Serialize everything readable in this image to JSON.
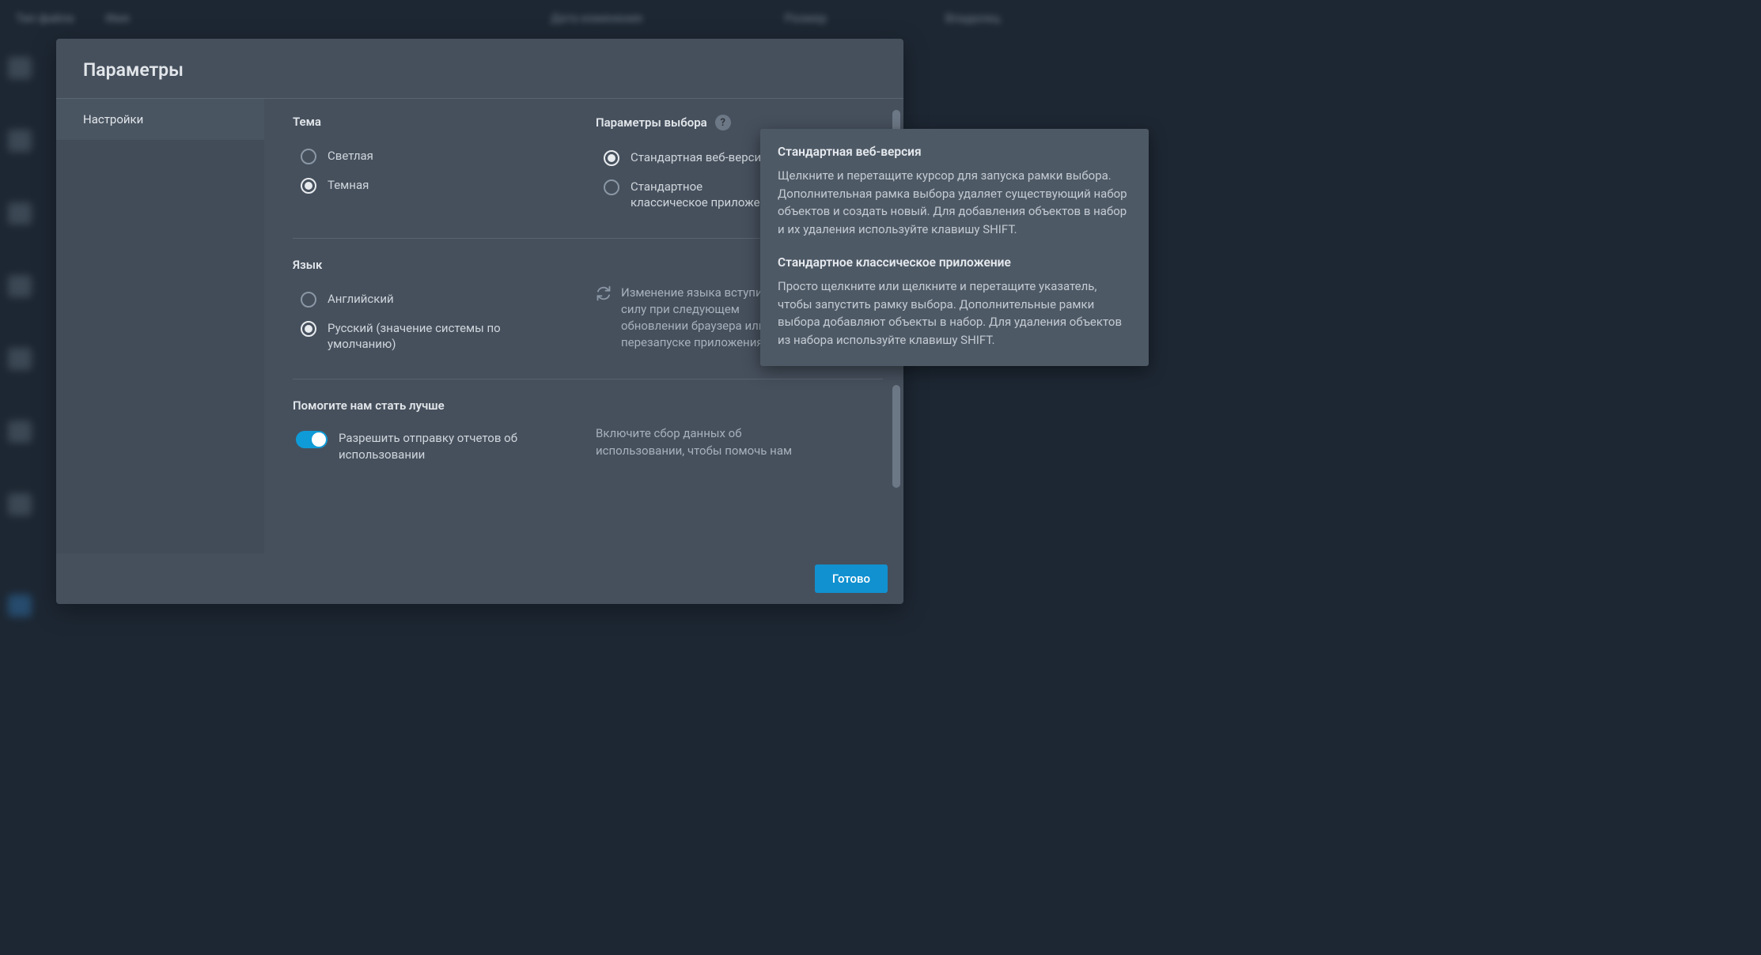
{
  "bg": {
    "col1": "Тип файла",
    "col2": "Имя",
    "col3": "Дата изменения",
    "col4": "Размер",
    "col5": "Владелец"
  },
  "modal": {
    "title": "Параметры",
    "sidebar": {
      "settings": "Настройки"
    },
    "theme": {
      "title": "Тема",
      "light": "Светлая",
      "dark": "Темная"
    },
    "selection": {
      "title": "Параметры выбора",
      "web": "Стандартная веб-версия",
      "classic": "Стандартное классическое приложение"
    },
    "language": {
      "title": "Язык",
      "english": "Английский",
      "russian": "Русский (значение системы по умолчанию)",
      "note": "Изменение языка вступит в силу при следующем обновлении браузера или перезапуске приложения"
    },
    "help_us": {
      "title": "Помогите нам стать лучше",
      "toggle_label": "Разрешить отправку отчетов об использовании",
      "desc": "Включите сбор данных об использовании, чтобы помочь нам"
    },
    "done": "Готово"
  },
  "tooltip": {
    "t1": "Стандартная веб-версия",
    "b1": "Щелкните и перетащите курсор для запуска рамки выбора. Дополнительная рамка выбора удаляет существующий набор объектов и создать новый. Для добавления объектов в набор и их удаления используйте клавишу SHIFT.",
    "t2": "Стандартное классическое приложение",
    "b2": "Просто щелкните или щелкните и перетащите указатель, чтобы запустить рамку выбора. Дополнительные рамки выбора добавляют объекты в набор. Для удаления объектов из набора используйте клавишу SHIFT."
  }
}
